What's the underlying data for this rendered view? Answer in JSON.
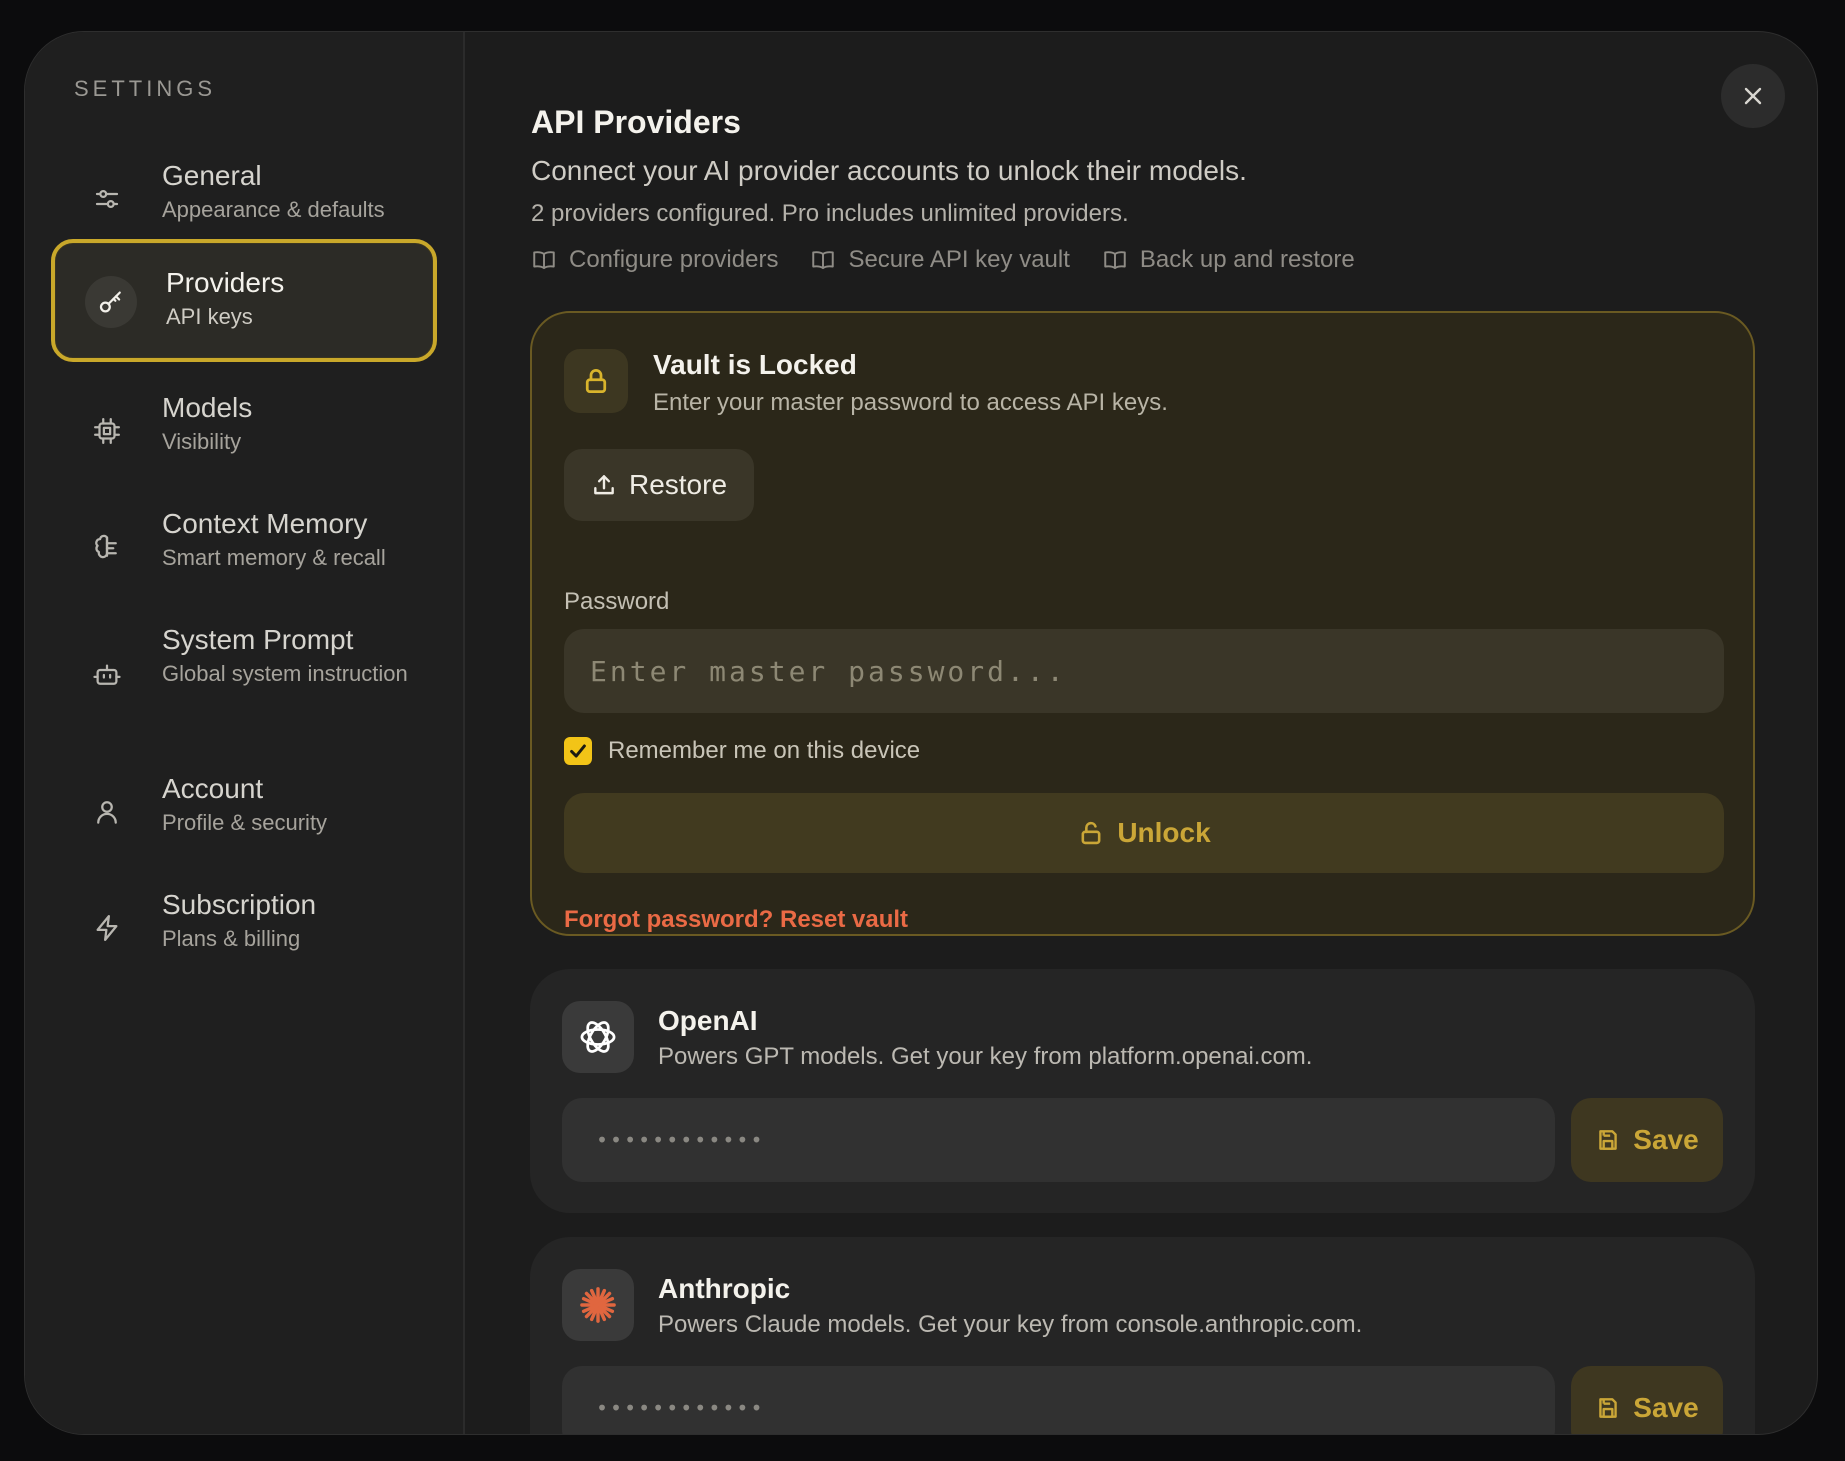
{
  "sidebar": {
    "heading": "SETTINGS",
    "items": [
      {
        "title": "General",
        "subtitle": "Appearance & defaults",
        "icon": "sliders-icon"
      },
      {
        "title": "Providers",
        "subtitle": "API keys",
        "icon": "key-icon",
        "active": true
      },
      {
        "title": "Models",
        "subtitle": "Visibility",
        "icon": "chip-icon"
      },
      {
        "title": "Context Memory",
        "subtitle": "Smart memory & recall",
        "icon": "brain-icon"
      },
      {
        "title": "System Prompt",
        "subtitle": "Global system instruction",
        "icon": "bot-icon"
      },
      {
        "title": "Account",
        "subtitle": "Profile & security",
        "icon": "user-icon"
      },
      {
        "title": "Subscription",
        "subtitle": "Plans & billing",
        "icon": "bolt-icon"
      }
    ]
  },
  "header": {
    "title": "API Providers",
    "subtitle": "Connect your AI provider accounts to unlock their models.",
    "status": "2 providers configured. Pro includes unlimited providers.",
    "links": [
      "Configure providers",
      "Secure API key vault",
      "Back up and restore"
    ]
  },
  "vault": {
    "title": "Vault is Locked",
    "subtitle": "Enter your master password to access API keys.",
    "restore_label": "Restore",
    "password_label": "Password",
    "password_placeholder": "Enter master password...",
    "remember_label": "Remember me on this device",
    "remember_checked": true,
    "unlock_label": "Unlock",
    "forgot_label": "Forgot password? Reset vault"
  },
  "providers": [
    {
      "name": "OpenAI",
      "description": "Powers GPT models. Get your key from platform.openai.com.",
      "key_placeholder": "••••••••••••",
      "save_label": "Save",
      "icon": "openai-logo-icon"
    },
    {
      "name": "Anthropic",
      "description": "Powers Claude models. Get your key from console.anthropic.com.",
      "key_placeholder": "••••••••••••",
      "save_label": "Save",
      "icon": "anthropic-logo-icon"
    }
  ],
  "colors": {
    "accent": "#c9a82a",
    "danger": "#ea6a45",
    "anthropic": "#e0663f"
  }
}
